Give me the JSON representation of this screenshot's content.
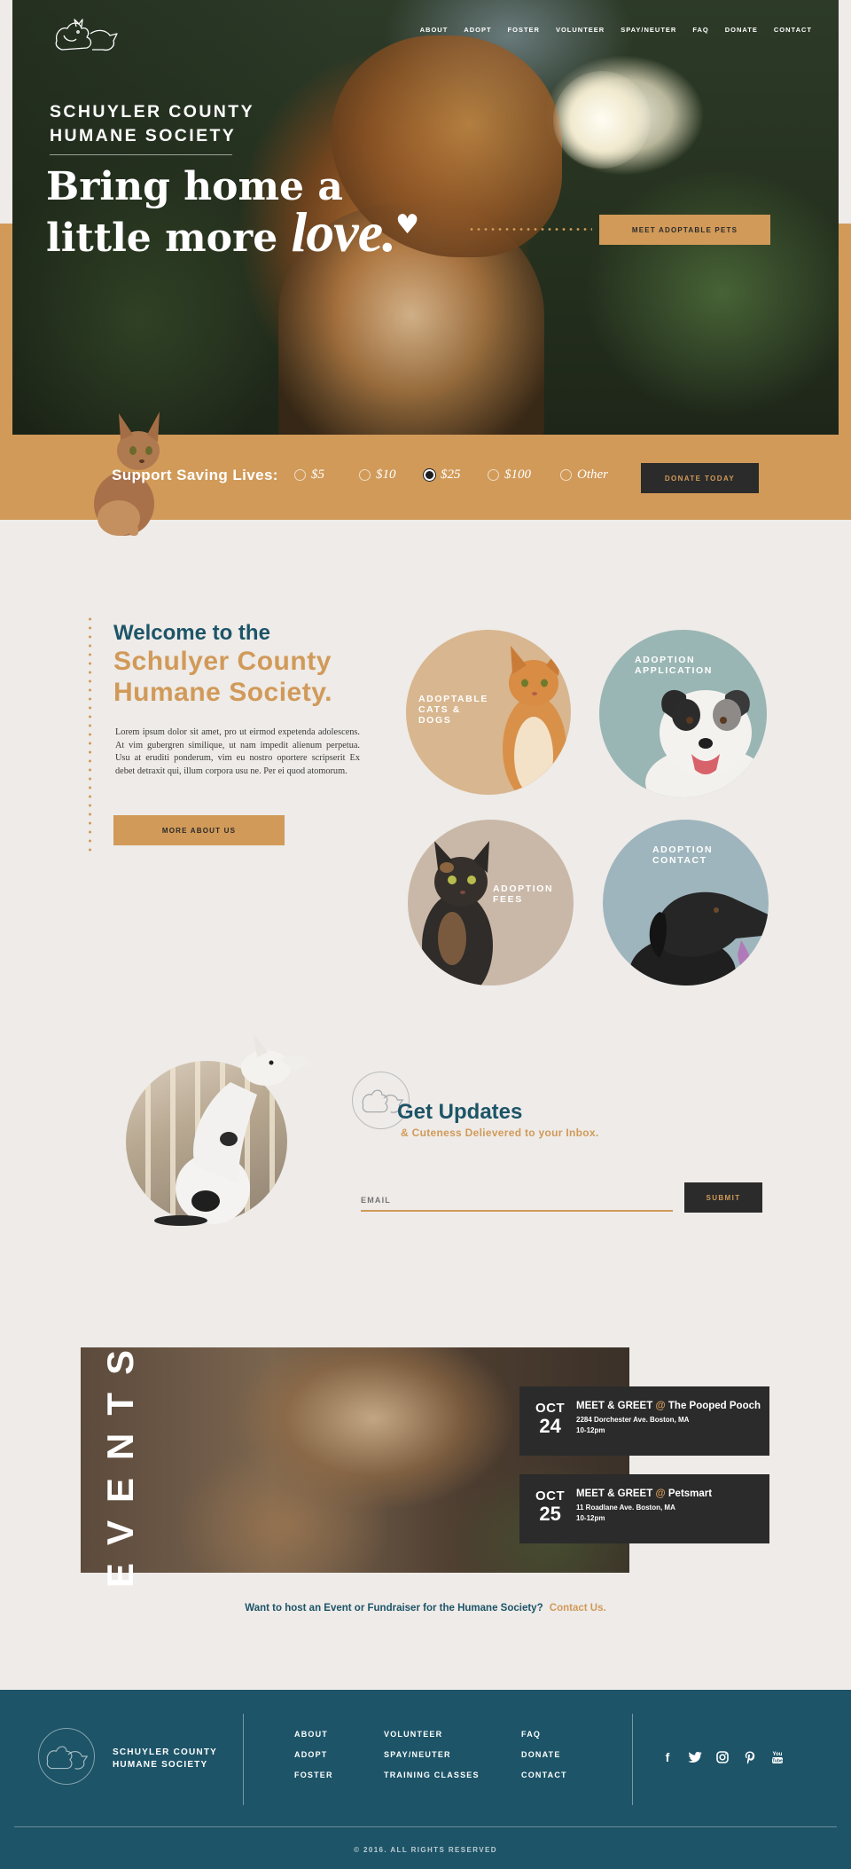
{
  "nav": {
    "items": [
      "ABOUT",
      "ADOPT",
      "FOSTER",
      "VOLUNTEER",
      "SPAY/NEUTER",
      "FAQ",
      "DONATE",
      "CONTACT"
    ]
  },
  "hero": {
    "org_line1": "SCHUYLER COUNTY",
    "org_line2": "HUMANE SOCIETY",
    "headline_line1": "Bring home a",
    "headline_line2": "little more",
    "headline_love": "love.",
    "cta": "MEET ADOPTABLE PETS"
  },
  "donate": {
    "label": "Support Saving Lives:",
    "options": [
      "$5",
      "$10",
      "$25",
      "$100",
      "Other"
    ],
    "selected": "$25",
    "button": "DONATE TODAY"
  },
  "welcome": {
    "title_small": "Welcome to the",
    "title_line1": "Schulyer County",
    "title_line2": "Humane Society.",
    "body": "Lorem ipsum dolor sit amet, pro ut eirmod expetenda adolescens. At vim gubergren similique, ut nam impedit alienum perpetua. Usu at eruditi ponderum, vim eu nostro oportere scripserit Ex debet detraxit qui, illum corpora usu ne. Per ei quod atomorum.",
    "button": "MORE ABOUT US"
  },
  "tiles": [
    {
      "line1": "ADOPTABLE",
      "line2": "CATS &",
      "line3": "DOGS"
    },
    {
      "line1": "ADOPTION",
      "line2": "APPLICATION"
    },
    {
      "line1": "ADOPTION",
      "line2": "FEES"
    },
    {
      "line1": "ADOPTION",
      "line2": "CONTACT"
    }
  ],
  "updates": {
    "title": "Get Updates",
    "subtitle": "& Cuteness Delievered to your Inbox.",
    "email_placeholder": "EMAIL",
    "button": "SUBMIT"
  },
  "events": {
    "heading": "EVENTS",
    "items": [
      {
        "month": "OCT",
        "day": "24",
        "title": "MEET & GREET",
        "at": "@",
        "venue": "The Pooped Pooch",
        "address": "2284 Dorchester Ave. Boston, MA",
        "time": "10-12pm"
      },
      {
        "month": "OCT",
        "day": "25",
        "title": "MEET & GREET",
        "at": "@",
        "venue": "Petsmart",
        "address": "11 Roadlane Ave. Boston, MA",
        "time": "10-12pm"
      }
    ],
    "host_text": "Want to host an Event or Fundraiser for the Humane Society?",
    "host_link": "Contact Us."
  },
  "footer": {
    "org_line1": "SCHUYLER COUNTY",
    "org_line2": "HUMANE SOCIETY",
    "col1": [
      "ABOUT",
      "ADOPT",
      "FOSTER"
    ],
    "col2": [
      "VOLUNTEER",
      "SPAY/NEUTER",
      "TRAINING CLASSES"
    ],
    "col3": [
      "FAQ",
      "DONATE",
      "CONTACT"
    ],
    "social": [
      "facebook-icon",
      "twitter-icon",
      "instagram-icon",
      "pinterest-icon",
      "youtube-icon"
    ],
    "copyright": "© 2016. ALL RIGHTS RESERVED"
  },
  "colors": {
    "tan": "#d19a59",
    "teal": "#1d5468",
    "dark": "#2b2b2b",
    "background": "#eeebe8"
  }
}
